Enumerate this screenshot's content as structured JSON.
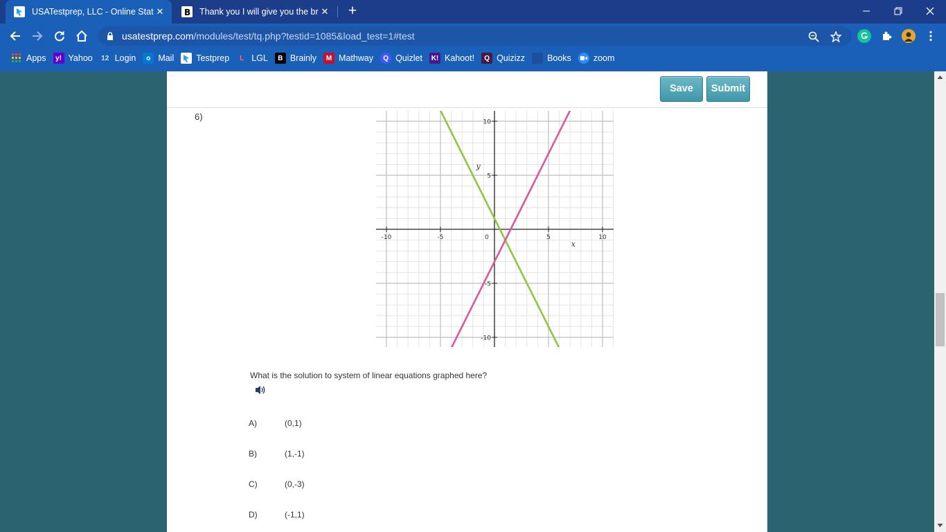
{
  "tabs": [
    {
      "title": "USATestprep, LLC - Online State-",
      "active": true
    },
    {
      "title": "Thank you I will give you the brai",
      "active": false
    }
  ],
  "address": {
    "domain": "usatestprep.com",
    "path": "/modules/test/tq.php?testid=1085&load_test=1#test"
  },
  "bookmarks": [
    {
      "label": "Apps",
      "icon": "apps-grid-icon",
      "badge": "",
      "color": "#ea4335"
    },
    {
      "label": "Yahoo",
      "icon": "yahoo-icon",
      "badge": "y!",
      "color": "#6001d2"
    },
    {
      "label": "Login",
      "icon": "login-icon",
      "badge": "12",
      "color": "#1a60b8"
    },
    {
      "label": "Mail",
      "icon": "outlook-icon",
      "badge": "o",
      "color": "#0078d4"
    },
    {
      "label": "Testprep",
      "icon": "testprep-icon",
      "badge": "",
      "color": "#2f9fd8"
    },
    {
      "label": "LGL",
      "icon": "lgl-icon",
      "badge": "L",
      "color": "#d62728"
    },
    {
      "label": "Brainly",
      "icon": "brainly-icon",
      "badge": "B",
      "color": "#000000"
    },
    {
      "label": "Mathway",
      "icon": "mathway-icon",
      "badge": "M",
      "color": "#c8102e"
    },
    {
      "label": "Quizlet",
      "icon": "quizlet-icon",
      "badge": "Q",
      "color": "#4255ff"
    },
    {
      "label": "Kahoot!",
      "icon": "kahoot-icon",
      "badge": "K!",
      "color": "#46178f"
    },
    {
      "label": "Quizizz",
      "icon": "quizizz-icon",
      "badge": "Q",
      "color": "#461a42"
    },
    {
      "label": "Books",
      "icon": "books-icon",
      "badge": "",
      "color": "#1f4e9c"
    },
    {
      "label": "zoom",
      "icon": "zoom-icon",
      "badge": "",
      "color": "#2d8cff"
    }
  ],
  "toolbar": {
    "save_label": "Save",
    "submit_label": "Submit"
  },
  "question": {
    "number": "6)",
    "text": "What is the solution to system of linear equations graphed here?",
    "choices": [
      {
        "letter": "A)",
        "value": "(0,1)"
      },
      {
        "letter": "B)",
        "value": "(1,-1)"
      },
      {
        "letter": "C)",
        "value": "(0,-3)"
      },
      {
        "letter": "D)",
        "value": "(-1,1)"
      }
    ]
  },
  "chart_data": {
    "type": "line",
    "title": "",
    "xlabel": "x",
    "ylabel": "y",
    "xlim": [
      -11,
      11
    ],
    "ylim": [
      -11,
      11
    ],
    "x_ticks": [
      -10,
      -5,
      0,
      5,
      10
    ],
    "x_tick_labels": [
      "-10",
      "-5",
      "0",
      "5",
      "10"
    ],
    "y_ticks": [
      10,
      5,
      -5,
      -10
    ],
    "y_tick_labels": [
      "10",
      "5",
      "-5",
      "-10"
    ],
    "grid": true,
    "series": [
      {
        "color": "#8dc63f",
        "x": [
          -5,
          6
        ],
        "y": [
          11,
          -11
        ]
      },
      {
        "color": "#d6589e",
        "x": [
          -4,
          7
        ],
        "y": [
          -11,
          11
        ]
      }
    ]
  },
  "colors": {
    "chrome": "#1a60b8",
    "tabstrip": "#1c3e8a",
    "page_bg": "#2b6370",
    "button": "#4aa3b5"
  }
}
